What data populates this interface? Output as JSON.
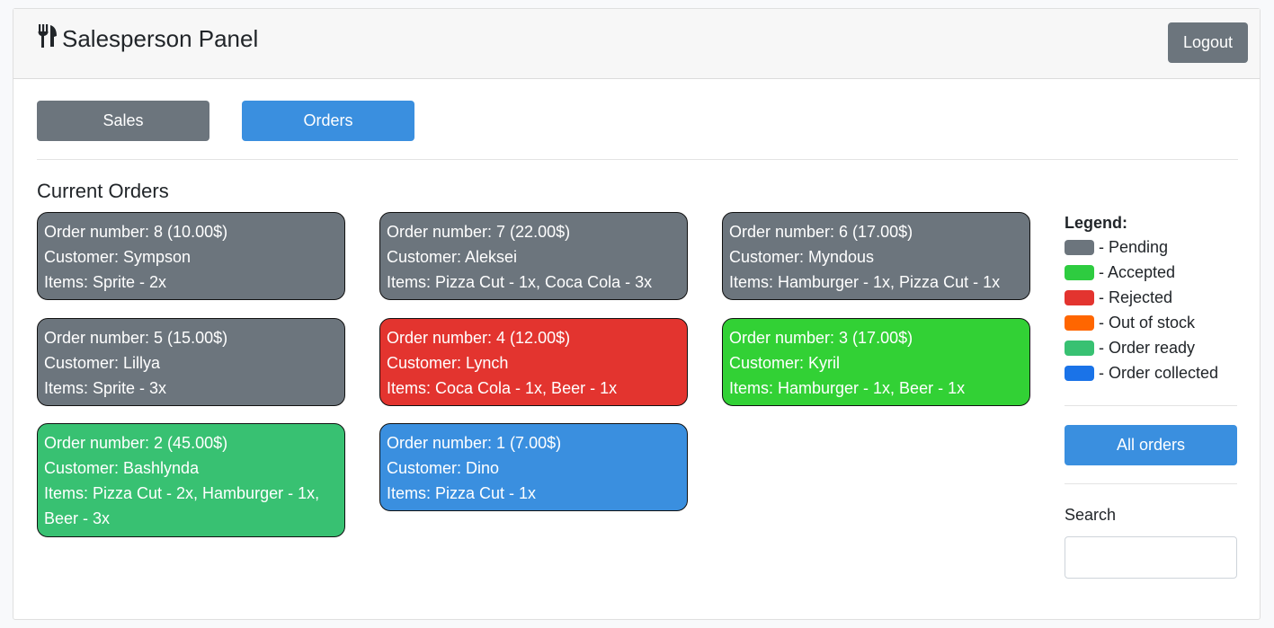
{
  "header": {
    "title": "Salesperson Panel",
    "logout_label": "Logout"
  },
  "nav": {
    "sales_label": "Sales",
    "orders_label": "Orders"
  },
  "main": {
    "title": "Current Orders"
  },
  "orders": [
    {
      "line1": "Order number: 8 (10.00$)",
      "line2": "Customer: Sympson",
      "line3": "Items: Sprite - 2x",
      "status": "pending"
    },
    {
      "line1": "Order number: 7 (22.00$)",
      "line2": "Customer: Aleksei",
      "line3": "Items: Pizza Cut - 1x, Coca Cola - 3x",
      "status": "pending"
    },
    {
      "line1": "Order number: 6 (17.00$)",
      "line2": "Customer: Myndous",
      "line3": "Items: Hamburger - 1x, Pizza Cut - 1x",
      "status": "pending"
    },
    {
      "line1": "Order number: 5 (15.00$)",
      "line2": "Customer: Lillya",
      "line3": "Items: Sprite - 3x",
      "status": "pending"
    },
    {
      "line1": "Order number: 4 (12.00$)",
      "line2": "Customer: Lynch",
      "line3": "Items: Coca Cola - 1x, Beer - 1x",
      "status": "rejected"
    },
    {
      "line1": "Order number: 3 (17.00$)",
      "line2": "Customer: Kyril",
      "line3": "Items: Hamburger - 1x, Beer - 1x",
      "status": "accepted"
    },
    {
      "line1": "Order number: 2 (45.00$)",
      "line2": "Customer: Bashlynda",
      "line3": "Items: Pizza Cut - 2x, Hamburger - 1x, Beer - 3x",
      "status": "ready"
    },
    {
      "line1": "Order number: 1 (7.00$)",
      "line2": "Customer: Dino",
      "line3": "Items: Pizza Cut - 1x",
      "status": "collected"
    }
  ],
  "legend": {
    "title": "Legend:",
    "items": [
      {
        "label": "- Pending",
        "color": "#6c757d"
      },
      {
        "label": "- Accepted",
        "color": "#2ecc40"
      },
      {
        "label": "- Rejected",
        "color": "#e3342f"
      },
      {
        "label": "- Out of stock",
        "color": "#ff6600"
      },
      {
        "label": "- Order ready",
        "color": "#38c172"
      },
      {
        "label": "- Order collected",
        "color": "#1a73e8"
      }
    ]
  },
  "status_colors": {
    "pending": "#6c757d",
    "accepted": "#32d135",
    "rejected": "#e3342f",
    "ready": "#38c172",
    "collected": "#3a8fdf"
  },
  "sidebar": {
    "all_orders_label": "All orders",
    "search_label": "Search",
    "search_value": ""
  }
}
